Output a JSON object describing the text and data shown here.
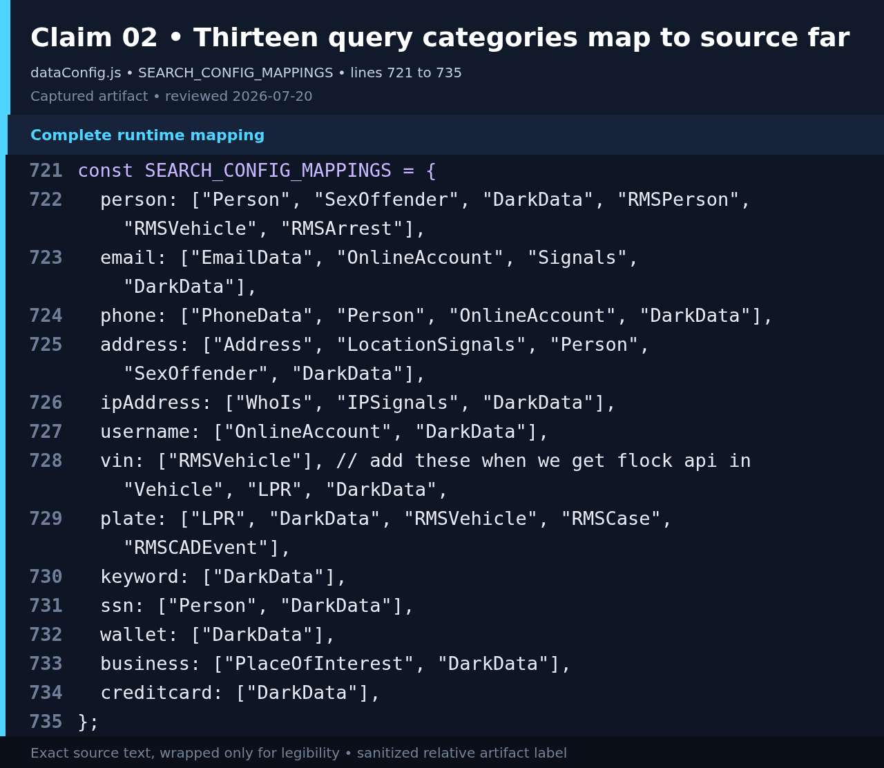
{
  "header": {
    "title": "Claim 02 • Thirteen query categories map to source far",
    "source": "dataConfig.js • SEARCH_CONFIG_MAPPINGS • lines 721 to 735",
    "meta": "Captured artifact • reviewed 2026-07-20"
  },
  "section": {
    "title": "Complete runtime mapping"
  },
  "code_lines": [
    {
      "number": "721",
      "kind": "declaration",
      "wrapped": [
        "const SEARCH_CONFIG_MAPPINGS = {"
      ]
    },
    {
      "number": "722",
      "kind": "entry",
      "wrapped": [
        "person: [\"Person\", \"SexOffender\", \"DarkData\", \"RMSPerson\",",
        "\"RMSVehicle\", \"RMSArrest\"],"
      ]
    },
    {
      "number": "723",
      "kind": "entry",
      "wrapped": [
        "email: [\"EmailData\", \"OnlineAccount\", \"Signals\",",
        "\"DarkData\"],"
      ]
    },
    {
      "number": "724",
      "kind": "entry",
      "wrapped": [
        "phone: [\"PhoneData\", \"Person\", \"OnlineAccount\", \"DarkData\"],"
      ]
    },
    {
      "number": "725",
      "kind": "entry",
      "wrapped": [
        "address: [\"Address\", \"LocationSignals\", \"Person\",",
        "\"SexOffender\", \"DarkData\"],"
      ]
    },
    {
      "number": "726",
      "kind": "entry",
      "wrapped": [
        "ipAddress: [\"WhoIs\", \"IPSignals\", \"DarkData\"],"
      ]
    },
    {
      "number": "727",
      "kind": "entry",
      "wrapped": [
        "username: [\"OnlineAccount\", \"DarkData\"],"
      ]
    },
    {
      "number": "728",
      "kind": "entry",
      "wrapped": [
        "vin: [\"RMSVehicle\"], // add these when we get flock api in",
        "\"Vehicle\", \"LPR\", \"DarkData\","
      ]
    },
    {
      "number": "729",
      "kind": "entry",
      "wrapped": [
        "plate: [\"LPR\", \"DarkData\", \"RMSVehicle\", \"RMSCase\",",
        "\"RMSCADEvent\"],"
      ]
    },
    {
      "number": "730",
      "kind": "entry",
      "wrapped": [
        "keyword: [\"DarkData\"],"
      ]
    },
    {
      "number": "731",
      "kind": "entry",
      "wrapped": [
        "ssn: [\"Person\", \"DarkData\"],"
      ]
    },
    {
      "number": "732",
      "kind": "entry",
      "wrapped": [
        "wallet: [\"DarkData\"],"
      ]
    },
    {
      "number": "733",
      "kind": "entry",
      "wrapped": [
        "business: [\"PlaceOfInterest\", \"DarkData\"],"
      ]
    },
    {
      "number": "734",
      "kind": "entry",
      "wrapped": [
        "creditcard: [\"DarkData\"],"
      ]
    },
    {
      "number": "735",
      "kind": "closing",
      "wrapped": [
        "};"
      ]
    }
  ],
  "footer": {
    "note": "Exact source text, wrapped only for legibility • sanitized relative artifact label"
  }
}
